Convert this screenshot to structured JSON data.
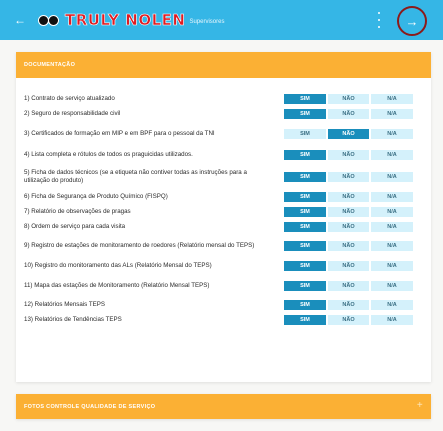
{
  "appbar": {
    "logo_text": "TRULY NOLEN",
    "logo_subtitle": "Supervisores",
    "back_icon": "arrow-left-icon",
    "menu_icon": "more-vertical-icon",
    "forward_icon": "arrow-right-icon"
  },
  "section_documentacao": {
    "title": "DOCUMENTAÇÃO",
    "option_labels": {
      "sim": "SIM",
      "nao": "NÃO",
      "na": "N/A"
    },
    "items": [
      {
        "question": "1) Contrato de serviço atualizado",
        "selected": "SIM"
      },
      {
        "question": "2) Seguro de responsabilidade civil",
        "selected": "SIM"
      },
      {
        "question": "3) Certificados de formação em MIP e em BPF para o pessoal da TNI",
        "selected": "NÃO"
      },
      {
        "question": "4) Lista completa e rótulos de todos os praguicidas utilizados.",
        "selected": "SIM"
      },
      {
        "question": "5) Ficha de dados técnicos (se a etiqueta não contiver todas as instruções para a utilização do produto)",
        "selected": "SIM"
      },
      {
        "question": "6) Ficha de Segurança de Produto Químico (FISPQ)",
        "selected": "SIM"
      },
      {
        "question": "7) Relatório de observações de pragas",
        "selected": "SIM"
      },
      {
        "question": "8) Ordem de serviço para cada visita",
        "selected": "SIM"
      },
      {
        "question": "9) Registro de estações de monitoramento de roedores (Relatório mensal do TEPS)",
        "selected": "SIM"
      },
      {
        "question": "10) Registro do monitoramento das ALs (Relatório Mensal do TEPS)",
        "selected": "SIM"
      },
      {
        "question": "11) Mapa das estações de Monitoramento (Relatório Mensal TEPS)",
        "selected": "SIM"
      },
      {
        "question": "12) Relatórios Mensais TEPS",
        "selected": "SIM"
      },
      {
        "question": "13) Relatórios de Tendências TEPS",
        "selected": "SIM"
      }
    ]
  },
  "section_fotos": {
    "title": "FOTOS CONTROLE QUALIDADE DE SERVIÇO",
    "expand_icon": "plus-icon",
    "expand_symbol": "+"
  },
  "colors": {
    "appbar": "#35b6e6",
    "section_header": "#fbb034",
    "option_selected": "#1a8ebc",
    "option_unselected": "#d4f1fb",
    "logo_red": "#e01b22",
    "highlight_circle": "#8c1a1a"
  }
}
